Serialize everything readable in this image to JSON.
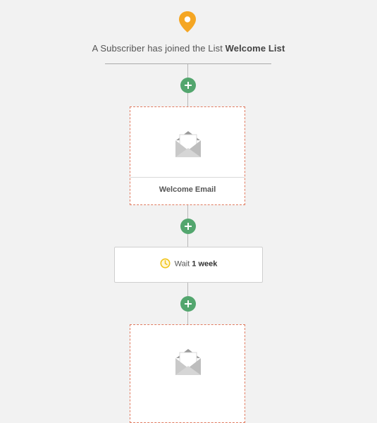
{
  "trigger": {
    "icon": "map-pin-icon",
    "prefix": "A Subscriber has joined the List",
    "list_name": "Welcome List",
    "color": "#f5a623"
  },
  "steps": [
    {
      "type": "add",
      "icon": "plus-icon"
    },
    {
      "type": "email",
      "label": "Welcome Email",
      "icon": "envelope-icon"
    },
    {
      "type": "add",
      "icon": "plus-icon"
    },
    {
      "type": "wait",
      "prefix": "Wait",
      "duration": "1 week",
      "icon": "clock-icon"
    },
    {
      "type": "add",
      "icon": "plus-icon"
    },
    {
      "type": "email",
      "label": "",
      "icon": "envelope-icon"
    }
  ],
  "colors": {
    "add_button": "#53a66e",
    "email_card_border": "#e07a5f",
    "background": "#f2f2f2"
  }
}
